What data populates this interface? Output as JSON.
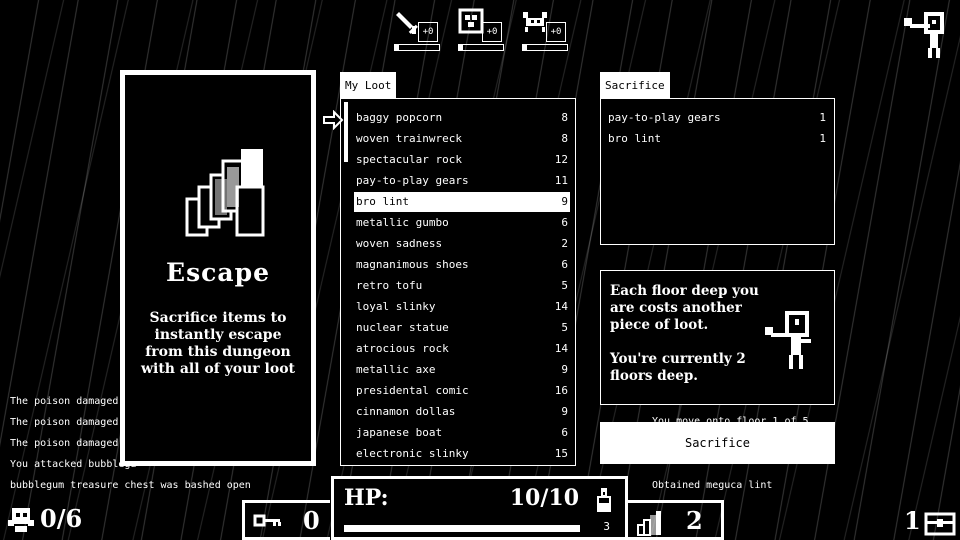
{
  "hud": {
    "attack_bonus": "+0",
    "defense_bonus": "+0",
    "speed_bonus": "+0"
  },
  "escape": {
    "title": "Escape",
    "description": "Sacrifice items to instantly escape from this dungeon with all of your loot"
  },
  "loot": {
    "tab_label": "My Loot",
    "items": [
      {
        "name": "baggy popcorn",
        "qty": "8"
      },
      {
        "name": "woven trainwreck",
        "qty": "8"
      },
      {
        "name": "spectacular rock",
        "qty": "12"
      },
      {
        "name": "pay-to-play gears",
        "qty": "11"
      },
      {
        "name": "bro lint",
        "qty": "9"
      },
      {
        "name": "metallic gumbo",
        "qty": "6"
      },
      {
        "name": "woven sadness",
        "qty": "2"
      },
      {
        "name": "magnanimous shoes",
        "qty": "6"
      },
      {
        "name": "retro tofu",
        "qty": "5"
      },
      {
        "name": "loyal slinky",
        "qty": "14"
      },
      {
        "name": "nuclear statue",
        "qty": "5"
      },
      {
        "name": "atrocious rock",
        "qty": "14"
      },
      {
        "name": "metallic axe",
        "qty": "9"
      },
      {
        "name": "presidental comic",
        "qty": "16"
      },
      {
        "name": "cinnamon dollas",
        "qty": "9"
      },
      {
        "name": "japanese boat",
        "qty": "6"
      },
      {
        "name": "electronic slinky",
        "qty": "15"
      }
    ],
    "selected_index": 4
  },
  "sacrifice": {
    "tab_label": "Sacrifice",
    "items": [
      {
        "name": "pay-to-play gears",
        "qty": "1"
      },
      {
        "name": "bro lint",
        "qty": "1"
      }
    ],
    "button_label": "Sacrifice"
  },
  "info": {
    "line1": "Each floor deep you",
    "line2": "are costs another",
    "line3": "piece of loot.",
    "line4": "You're currently 2",
    "line5": "floors deep."
  },
  "log": {
    "left": [
      "The poison damaged yo",
      "The poison damaged yo",
      "The poison damaged yo",
      "You attacked bubblega",
      "bubblegum treasure chest was bashed open"
    ],
    "right_partial": "You move onto floor 1 of 5",
    "right": "Obtained meguca lint"
  },
  "stats": {
    "hp_label": "HP:",
    "hp_value": "10/10",
    "potions": "3",
    "keys": "0",
    "floor": "2",
    "kills": "0/6",
    "chests": "1"
  }
}
